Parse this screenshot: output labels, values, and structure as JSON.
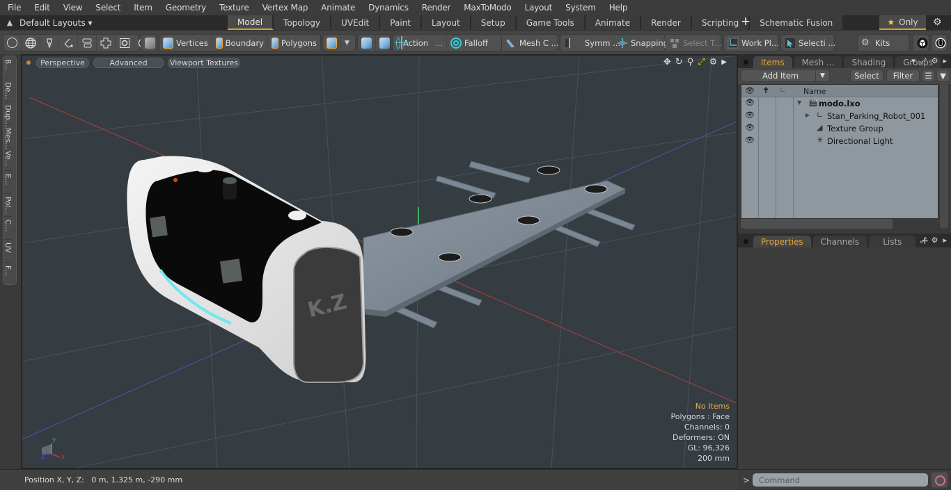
{
  "menu": [
    "File",
    "Edit",
    "View",
    "Select",
    "Item",
    "Geometry",
    "Texture",
    "Vertex Map",
    "Animate",
    "Dynamics",
    "Render",
    "MaxToModo",
    "Layout",
    "System",
    "Help"
  ],
  "layout_bar": {
    "layouts_label": "Default Layouts ▾",
    "tabs": [
      "Model",
      "Topology",
      "UVEdit",
      "Paint",
      "Layout",
      "Setup",
      "Game Tools",
      "Animate",
      "Render",
      "Scripting",
      "Schematic Fusion"
    ],
    "active_tab": "Model",
    "add_tab": "+",
    "only_label": "Only",
    "accent_color": "#e39a2b"
  },
  "toolbar": {
    "selection_modes": {
      "vertices": "Vertices",
      "boundary": "Boundary",
      "polygons": "Polygons"
    },
    "action": "Action",
    "action_more": "...",
    "falloff": "Falloff",
    "mesh_constraints": "Mesh C ...",
    "symmetry": "Symm ...",
    "snapping": "Snapping",
    "select_through": "Select T...",
    "work_plane": "Work Pl...",
    "selection_sets": "Selecti ...",
    "kits": "Kits"
  },
  "side_tabs": [
    "B...",
    "De...",
    "Dup...",
    "Mes...",
    "Ve...",
    "E...",
    "Pol...",
    "C...",
    "UV",
    "F..."
  ],
  "viewport": {
    "view_mode": "Perspective",
    "shading": "Advanced",
    "textures": "Viewport Textures",
    "info": {
      "selection": "No Items",
      "polygons": "Polygons : Face",
      "channels": "Channels: 0",
      "deformers": "Deformers: ON",
      "gl": "GL: 96,326",
      "grid": "200 mm"
    },
    "axis_labels": {
      "x": "X",
      "y": "Y",
      "z": "Z"
    }
  },
  "status": {
    "position_label": "Position X, Y, Z:",
    "position_value": "0 m, 1.325 m, -290 mm"
  },
  "items_panel": {
    "tabs": [
      "Items",
      "Mesh ...",
      "Shading",
      "Groups"
    ],
    "active_tab": "Items",
    "add_item": "Add Item",
    "select": "Select",
    "filter": "Filter",
    "column_name": "Name",
    "tree": [
      {
        "label": "modo.lxo",
        "level": 0,
        "bold": true,
        "icon": "scene-icon",
        "expanded": true
      },
      {
        "label": "Stan_Parking_Robot_001",
        "level": 1,
        "icon": "mesh-locator-icon",
        "expandable": true
      },
      {
        "label": "Texture Group",
        "level": 1,
        "icon": "texture-group-icon"
      },
      {
        "label": "Directional Light",
        "level": 1,
        "icon": "directional-light-icon"
      }
    ]
  },
  "properties_panel": {
    "tabs": [
      "Properties",
      "Channels",
      "Lists"
    ],
    "active_tab": "Properties",
    "add_tab": "+"
  },
  "command": {
    "prompt": ">",
    "placeholder": "Command"
  }
}
